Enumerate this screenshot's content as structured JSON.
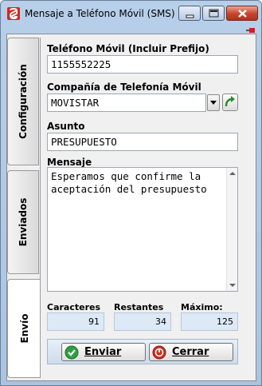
{
  "window": {
    "title": "Mensaje a Teléfono Móvil (SMS)",
    "icons": {
      "app": "sms-app-icon",
      "minimize": "minimize-icon",
      "maximize": "maximize-icon",
      "close": "close-icon",
      "pin": "pin-icon"
    }
  },
  "tabs": [
    {
      "label": "Configuración",
      "active": false
    },
    {
      "label": "Enviados",
      "active": false
    },
    {
      "label": "Envío",
      "active": true
    }
  ],
  "form": {
    "phone_label": "Teléfono Móvil (Incluir Prefijo)",
    "phone_value": "1155552225",
    "company_label": "Compañía de Telefonía Móvil",
    "company_value": "MOVISTAR",
    "subject_label": "Asunto",
    "subject_value": "PRESUPUESTO",
    "message_label": "Mensaje",
    "message_value": "Esperamos que confirme la\naceptación del presupuesto"
  },
  "counters": {
    "characters_label": "Caracteres",
    "characters_value": "91",
    "remaining_label": "Restantes",
    "remaining_value": "34",
    "max_label": "Máximo:",
    "max_value": "125"
  },
  "buttons": {
    "send_label": "Enviar",
    "close_label": "Cerrar"
  },
  "colors": {
    "send_icon": "#2ea043",
    "close_icon": "#d42a1f",
    "title_bar": "#b7cfe9"
  }
}
